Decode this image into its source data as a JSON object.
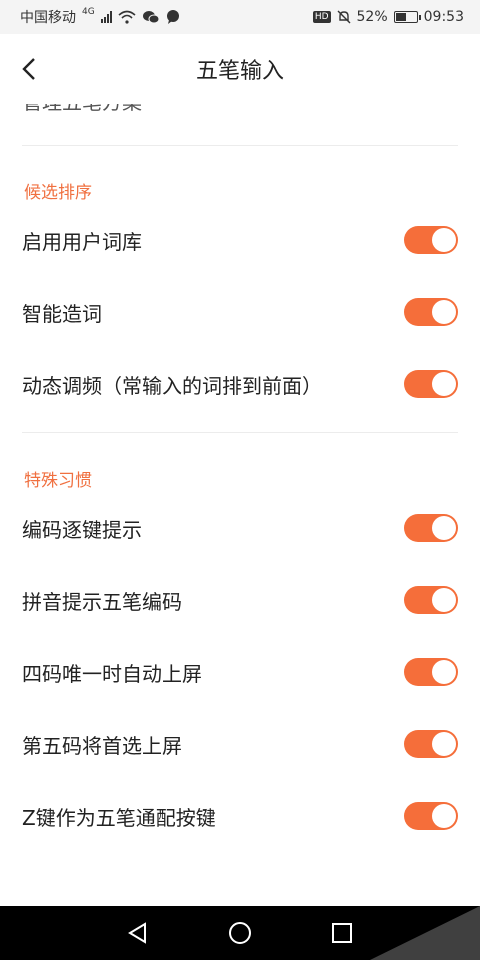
{
  "status_bar": {
    "carrier": "中国移动",
    "network": "4G",
    "hd": "HD",
    "battery_percent": "52%",
    "battery_level": 0.52,
    "time": "09:53"
  },
  "header": {
    "title": "五笔输入"
  },
  "partial_item": {
    "label": "管理五笔方案"
  },
  "sections": [
    {
      "title": "候选排序",
      "items": [
        {
          "label": "启用用户词库",
          "on": true
        },
        {
          "label": "智能造词",
          "on": true
        },
        {
          "label": "动态调频（常输入的词排到前面）",
          "on": true
        }
      ]
    },
    {
      "title": "特殊习惯",
      "items": [
        {
          "label": "编码逐键提示",
          "on": true
        },
        {
          "label": "拼音提示五笔编码",
          "on": true
        },
        {
          "label": "四码唯一时自动上屏",
          "on": true
        },
        {
          "label": "第五码将首选上屏",
          "on": true
        },
        {
          "label": "Z键作为五笔通配按键",
          "on": true
        }
      ]
    }
  ],
  "colors": {
    "accent": "#f56e3a",
    "section_header": "#f07040"
  }
}
